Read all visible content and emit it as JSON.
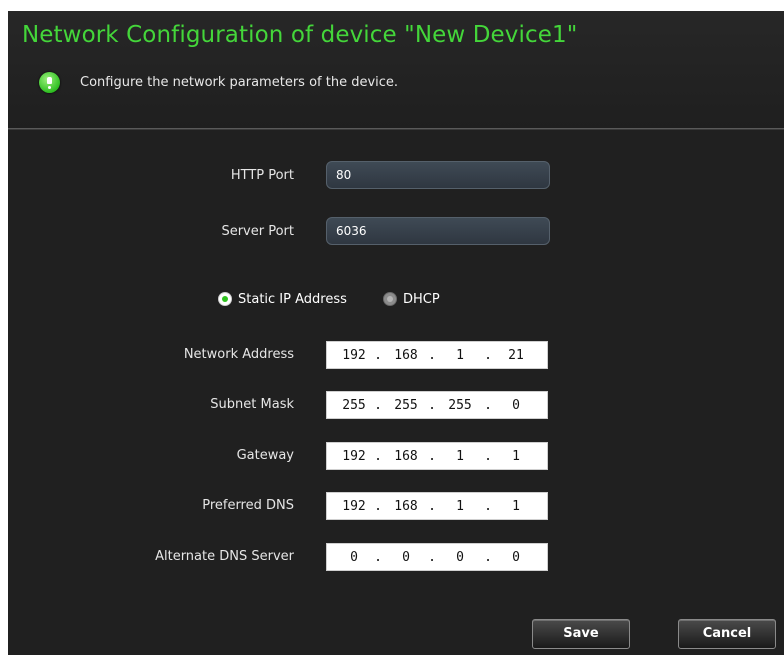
{
  "dialog": {
    "title": "Network Configuration of device \"New Device1\"",
    "hint": "Configure the network parameters of the device."
  },
  "ports": {
    "http_label": "HTTP Port",
    "http_value": "80",
    "server_label": "Server Port",
    "server_value": "6036"
  },
  "ip_mode": {
    "static_label": "Static IP Address",
    "dhcp_label": "DHCP",
    "selected": "static"
  },
  "network": {
    "address_label": "Network Address",
    "address": [
      "192",
      "168",
      "1",
      "21"
    ],
    "mask_label": "Subnet Mask",
    "mask": [
      "255",
      "255",
      "255",
      "0"
    ],
    "gateway_label": "Gateway",
    "gateway": [
      "192",
      "168",
      "1",
      "1"
    ],
    "dns1_label": "Preferred DNS",
    "dns1": [
      "192",
      "168",
      "1",
      "1"
    ],
    "dns2_label": "Alternate DNS Server",
    "dns2": [
      "0",
      "0",
      "0",
      "0"
    ]
  },
  "buttons": {
    "save": "Save",
    "cancel": "Cancel"
  },
  "colors": {
    "title_green": "#44d63a",
    "background": "#202020",
    "radio_selected": "#2fc21f"
  },
  "icons": {
    "hint": "info-bubble-icon"
  }
}
